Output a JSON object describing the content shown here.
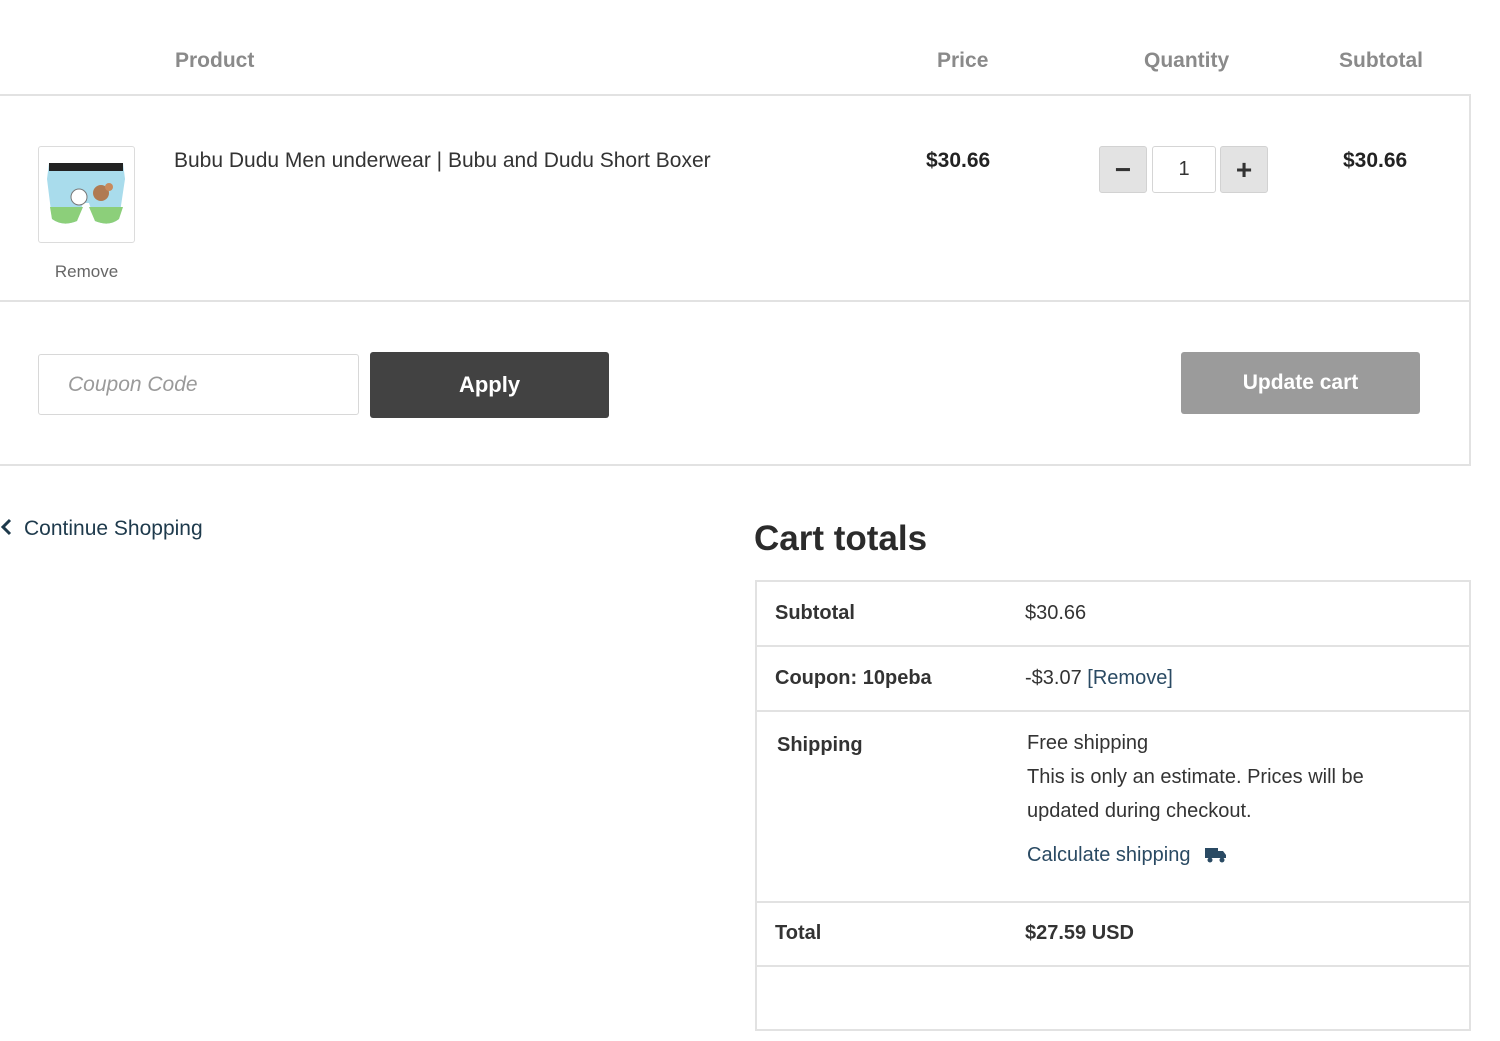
{
  "table_header": {
    "product": "Product",
    "price": "Price",
    "quantity": "Quantity",
    "subtotal": "Subtotal"
  },
  "cart_item": {
    "name": "Bubu Dudu Men underwear | Bubu and Dudu Short Boxer",
    "price": "$30.66",
    "quantity": "1",
    "subtotal": "$30.66",
    "remove_label": "Remove",
    "minus_symbol": "−",
    "plus_symbol": "+"
  },
  "coupon": {
    "placeholder": "Coupon Code",
    "apply_label": "Apply"
  },
  "update_cart_label": "Update cart",
  "continue_shopping": "Continue Shopping",
  "cart_totals": {
    "title": "Cart totals",
    "subtotal_label": "Subtotal",
    "subtotal_value": "$30.66",
    "coupon_label": "Coupon: 10peba",
    "coupon_value": "-$3.07",
    "coupon_remove": "[Remove]",
    "shipping_label": "Shipping",
    "shipping_method": "Free shipping",
    "shipping_note_line1": "This is only an estimate. Prices will be",
    "shipping_note_line2": "updated during checkout.",
    "calculate_shipping": "Calculate shipping",
    "total_label": "Total",
    "total_value": "$27.59 USD"
  },
  "colors": {
    "apply_button": "#424242",
    "update_button": "#9b9b9b",
    "link": "#1e3a4c"
  },
  "icons": [
    "chevron-left-icon",
    "truck-icon",
    "product-thumbnail"
  ]
}
